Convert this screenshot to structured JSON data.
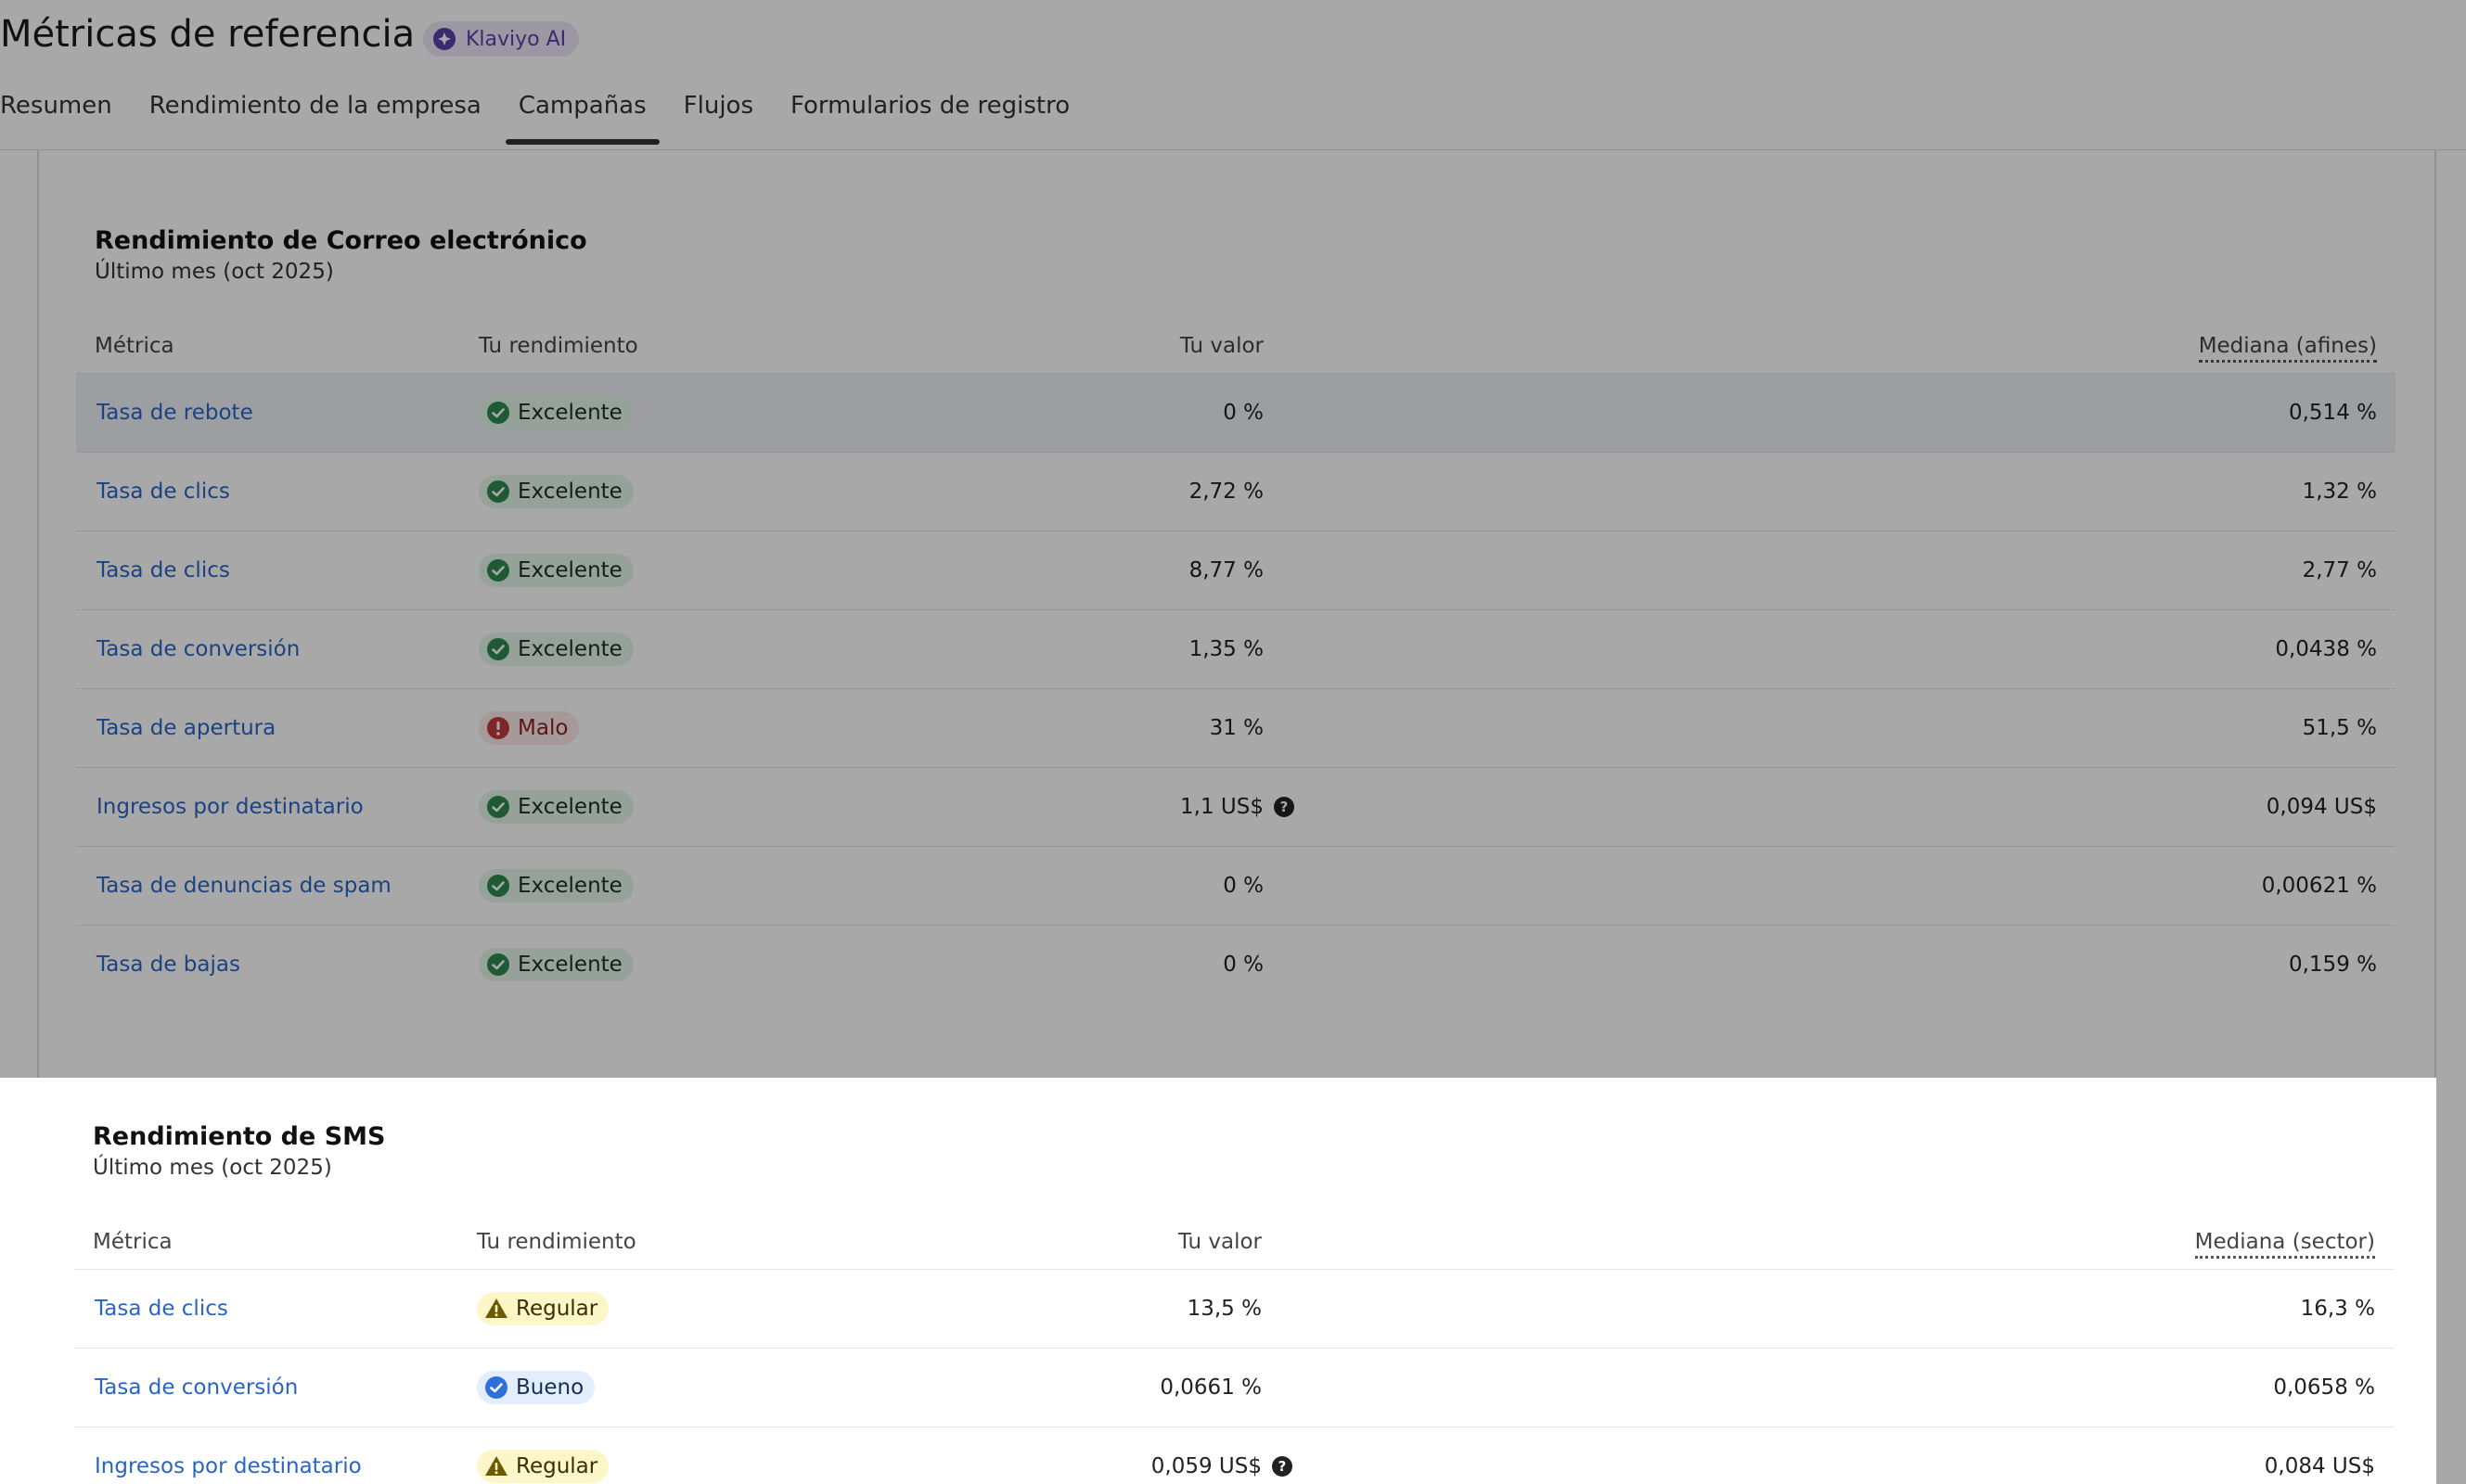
{
  "header": {
    "title": "Métricas de referencia",
    "ai_badge": "Klaviyo AI"
  },
  "tabs": [
    {
      "label": "Resumen",
      "active": false
    },
    {
      "label": "Rendimiento de la empresa",
      "active": false
    },
    {
      "label": "Campañas",
      "active": true
    },
    {
      "label": "Flujos",
      "active": false
    },
    {
      "label": "Formularios de registro",
      "active": false
    }
  ],
  "colors": {
    "link": "#2a64c5",
    "excelente": "#2e8b4f",
    "malo": "#c43a3a",
    "regular": "#7a6300",
    "bueno": "#2f6fdc"
  },
  "email": {
    "title": "Rendimiento de Correo electrónico",
    "subtitle": "Último mes (oct 2025)",
    "headers": {
      "metric": "Métrica",
      "perf": "Tu rendimiento",
      "value": "Tu valor",
      "median": "Mediana (afines)"
    },
    "rows": [
      {
        "metric": "Tasa de rebote",
        "status": "Excelente",
        "value": "0 %",
        "median": "0,514 %"
      },
      {
        "metric": "Tasa de clics",
        "status": "Excelente",
        "value": "2,72 %",
        "median": "1,32 %"
      },
      {
        "metric": "Tasa de clics",
        "status": "Excelente",
        "value": "8,77 %",
        "median": "2,77 %"
      },
      {
        "metric": "Tasa de conversión",
        "status": "Excelente",
        "value": "1,35 %",
        "median": "0,0438 %"
      },
      {
        "metric": "Tasa de apertura",
        "status": "Malo",
        "value": "31 %",
        "median": "51,5 %"
      },
      {
        "metric": "Ingresos por destinatario",
        "status": "Excelente",
        "value": "1,1 US$",
        "median": "0,094 US$"
      },
      {
        "metric": "Tasa de denuncias de spam",
        "status": "Excelente",
        "value": "0 %",
        "median": "0,00621 %"
      },
      {
        "metric": "Tasa de bajas",
        "status": "Excelente",
        "value": "0 %",
        "median": "0,159 %"
      }
    ]
  },
  "sms": {
    "title": "Rendimiento de SMS",
    "subtitle": "Último mes (oct 2025)",
    "headers": {
      "metric": "Métrica",
      "perf": "Tu rendimiento",
      "value": "Tu valor",
      "median": "Mediana (sector)"
    },
    "rows": [
      {
        "metric": "Tasa de clics",
        "status": "Regular",
        "value": "13,5 %",
        "median": "16,3 %"
      },
      {
        "metric": "Tasa de conversión",
        "status": "Bueno",
        "value": "0,0661 %",
        "median": "0,0658 %"
      },
      {
        "metric": "Ingresos por destinatario",
        "status": "Regular",
        "value": "0,059 US$",
        "median": "0,084 US$"
      }
    ]
  }
}
